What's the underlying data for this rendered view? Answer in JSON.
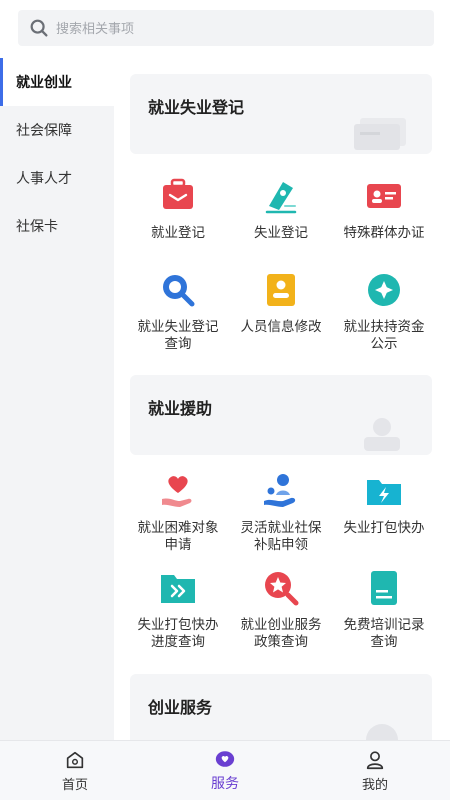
{
  "search": {
    "placeholder": "搜索相关事项"
  },
  "sidebar": {
    "items": [
      {
        "label": "就业创业"
      },
      {
        "label": "社会保障"
      },
      {
        "label": "人事人才"
      },
      {
        "label": "社保卡"
      }
    ]
  },
  "sections": [
    {
      "title": "就业失业登记",
      "items": [
        {
          "label": "就业登记",
          "icon": "briefcase-icon"
        },
        {
          "label": "失业登记",
          "icon": "pen-nib-icon"
        },
        {
          "label": "特殊群体办证",
          "icon": "id-card-icon"
        },
        {
          "label": "就业失业登记查询",
          "icon": "search-query-icon"
        },
        {
          "label": "人员信息修改",
          "icon": "user-doc-icon"
        },
        {
          "label": "就业扶持资金公示",
          "icon": "diamond-badge-icon"
        }
      ]
    },
    {
      "title": "就业援助",
      "items": [
        {
          "label": "就业困难对象申请",
          "icon": "heart-hand-icon"
        },
        {
          "label": "灵活就业社保补贴申领",
          "icon": "person-hand-icon"
        },
        {
          "label": "失业打包快办",
          "icon": "folder-lightning-icon"
        },
        {
          "label": "失业打包快办进度查询",
          "icon": "folder-forward-icon"
        },
        {
          "label": "就业创业服务政策查询",
          "icon": "star-search-icon"
        },
        {
          "label": "免费培训记录查询",
          "icon": "document-icon"
        }
      ]
    },
    {
      "title": "创业服务"
    }
  ],
  "tabbar": {
    "items": [
      {
        "label": "首页"
      },
      {
        "label": "服务"
      },
      {
        "label": "我的"
      }
    ]
  },
  "colors": {
    "accent": "#3d6de8",
    "active_tab": "#6a3fd1",
    "red": "#e8464f",
    "teal": "#1fb7b0",
    "amber": "#f2b21a",
    "blue": "#2f74d9"
  }
}
